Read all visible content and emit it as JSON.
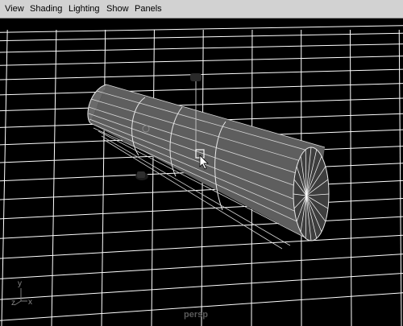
{
  "menubar": {
    "items": [
      "View",
      "Shading",
      "Lighting",
      "Show",
      "Panels"
    ]
  },
  "viewport": {
    "camera_label": "persp",
    "axis": {
      "z_label": "z",
      "x_label": "x",
      "y_label": "y"
    }
  },
  "icons": {
    "cursor": "move-cursor-icon",
    "manipulator": "move-manipulator-icon"
  },
  "colors": {
    "menubar_bg": "#d2d2d2",
    "viewport_bg": "#000000",
    "grid": "#ffffff",
    "mesh_fill": "#5e5e5e",
    "mesh_edges": "#e8e8e8"
  }
}
